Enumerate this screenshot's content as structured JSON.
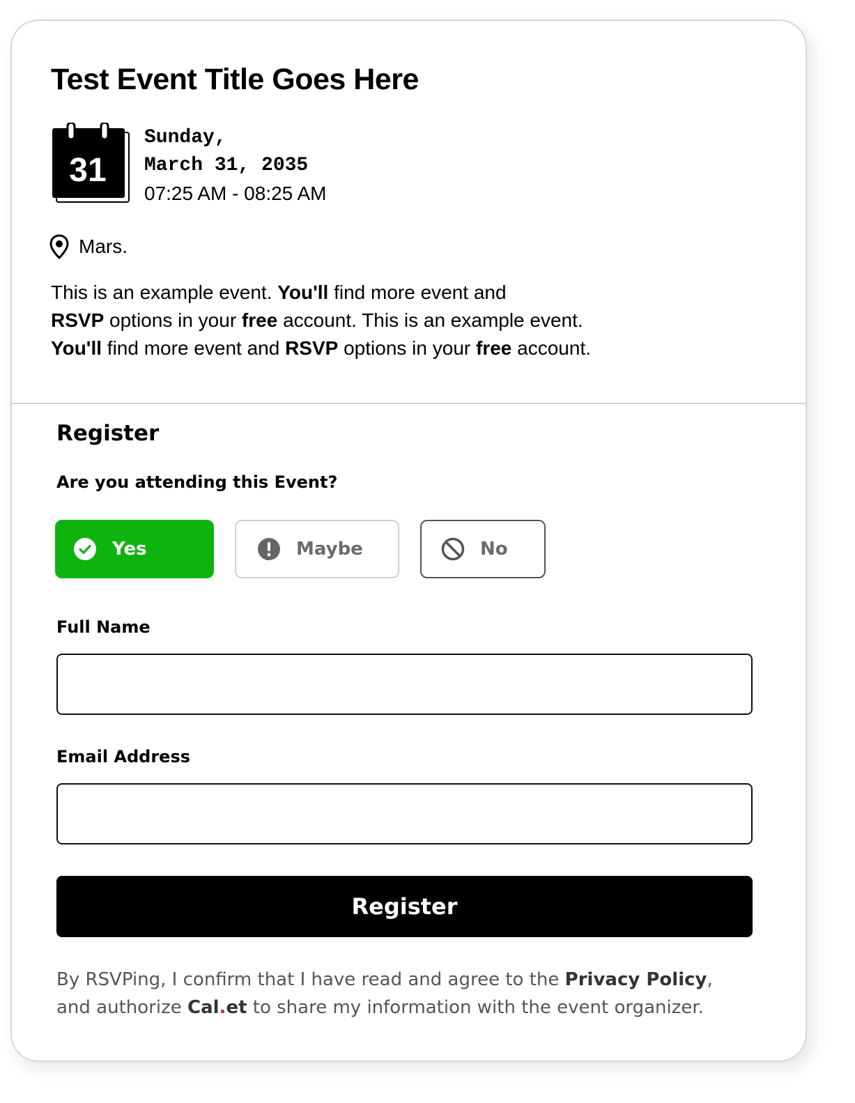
{
  "event": {
    "title": "Test Event Title Goes Here",
    "calendar_day": "31",
    "date_day": "Sunday,",
    "date_full": "March 31, 2035",
    "time_range": "07:25 AM - 08:25 AM",
    "location": "Mars."
  },
  "description": {
    "line1": {
      "t1": "This is an example event. ",
      "b1": "You'll",
      "t2": " find more event and"
    },
    "line2": {
      "b1": "RSVP",
      "t1": " options in your ",
      "b2": "free",
      "t2": " account. This is an example event."
    },
    "line3": {
      "b1": "You'll",
      "t1": " find more event and  ",
      "b2": "RSVP",
      "t2": " options in your ",
      "b3": "free",
      "t3": " account."
    }
  },
  "register": {
    "heading": "Register",
    "question": "Are you attending this Event?",
    "options": [
      {
        "label": "Yes",
        "icon": "check-circle-icon",
        "selected": true,
        "color": "#0fb30f"
      },
      {
        "label": "Maybe",
        "icon": "exclamation-circle-icon",
        "selected": false
      },
      {
        "label": "No",
        "icon": "prohibited-icon",
        "selected": false
      }
    ],
    "full_name_label": "Full Name",
    "full_name_value": "",
    "email_label": "Email Address",
    "email_value": "",
    "submit_label": "Register"
  },
  "legal": {
    "line1_text": "By RSVPing, I confirm that I have read and agree to the ",
    "privacy_link": "Privacy Policy",
    "line1_end": ",",
    "line2_text": "and authorize ",
    "brand_part1": "Cal",
    "brand_dot": ".",
    "brand_part2": "et",
    "line2_end": " to share my information with the event organizer."
  }
}
